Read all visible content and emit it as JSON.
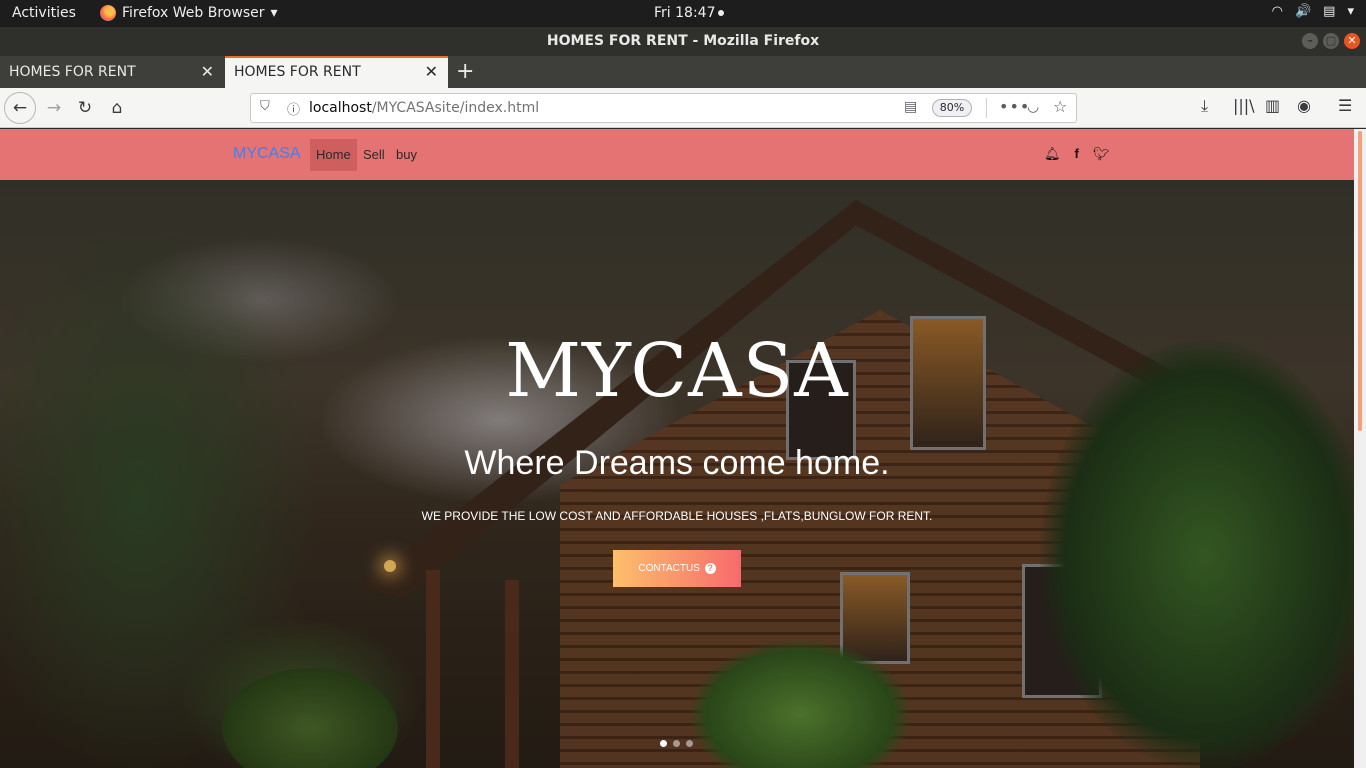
{
  "desktop": {
    "activities": "Activities",
    "app_menu": "Firefox Web Browser",
    "clock": "Fri 18:47"
  },
  "window": {
    "title": "HOMES FOR RENT - Mozilla Firefox"
  },
  "tabs": [
    {
      "label": "HOMES FOR RENT",
      "active": false
    },
    {
      "label": "HOMES FOR RENT",
      "active": true
    }
  ],
  "urlbar": {
    "host": "localhost",
    "path": "/MYCASAsite/index.html",
    "zoom": "80%"
  },
  "site": {
    "brand": "MYCASA",
    "nav": [
      "Home",
      "Sell",
      "buy"
    ],
    "hero": {
      "title": "MYCASA",
      "subtitle": "Where Dreams come home.",
      "description": "WE PROVIDE THE LOW COST AND AFFORDABLE HOUSES ,FLATS,BUNGLOW FOR RENT.",
      "cta": "CONTACTUS"
    },
    "carousel_active_index": 0,
    "carousel_count": 3,
    "colors": {
      "navbar": "#e57373",
      "brand": "#3b82f6",
      "cta_from": "#fcbf6b",
      "cta_to": "#f76b6b"
    }
  }
}
